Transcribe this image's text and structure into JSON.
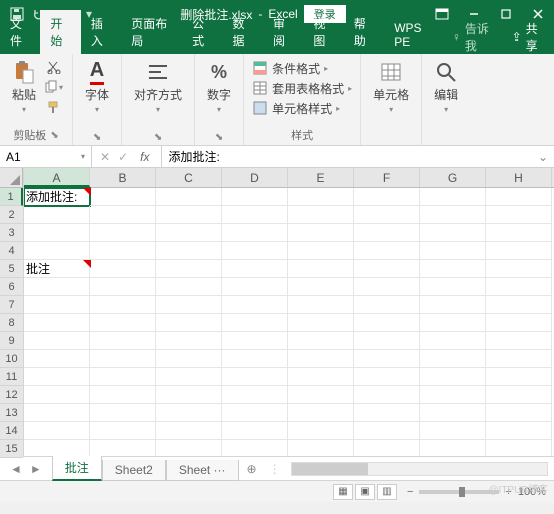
{
  "titlebar": {
    "filename": "删除批注.xlsx",
    "app": "Excel",
    "login": "登录"
  },
  "tabs": {
    "file": "文件",
    "home": "开始",
    "insert": "插入",
    "layout": "页面布局",
    "formulas": "公式",
    "data": "数据",
    "review": "审阅",
    "view": "视图",
    "help": "帮助",
    "wps": "WPS PE",
    "tellme": "告诉我",
    "share": "共享"
  },
  "ribbon": {
    "paste": "粘贴",
    "clipboard": "剪贴板",
    "font": "字体",
    "alignment": "对齐方式",
    "number": "数字",
    "cond_format": "条件格式",
    "table_format": "套用表格格式",
    "cell_styles": "单元格样式",
    "styles": "样式",
    "cells": "单元格",
    "editing": "编辑"
  },
  "formula": {
    "namebox": "A1",
    "fx": "fx",
    "value": "添加批注:"
  },
  "grid": {
    "cols": [
      "A",
      "B",
      "C",
      "D",
      "E",
      "F",
      "G",
      "H"
    ],
    "rows": [
      "1",
      "2",
      "3",
      "4",
      "5",
      "6",
      "7",
      "8",
      "9",
      "10",
      "11",
      "12",
      "13",
      "14",
      "15"
    ],
    "A1": "添加批注:",
    "A5": "批注"
  },
  "sheets": {
    "s1": "批注",
    "s2": "Sheet2",
    "s3": "Sheet",
    "more": "···"
  },
  "status": {
    "zoom": "100%"
  },
  "watermark": "@ITPUB博客"
}
